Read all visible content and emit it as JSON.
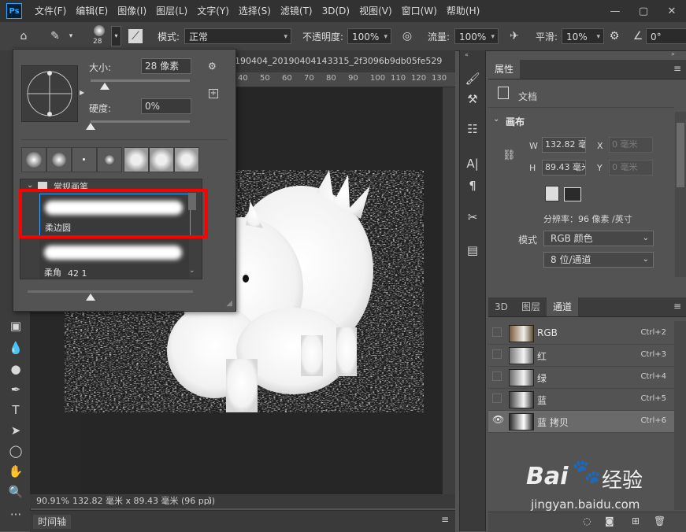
{
  "menubar": {
    "logo": "Ps",
    "items": [
      "文件(F)",
      "编辑(E)",
      "图像(I)",
      "图层(L)",
      "文字(Y)",
      "选择(S)",
      "滤镜(T)",
      "3D(D)",
      "视图(V)",
      "窗口(W)",
      "帮助(H)"
    ]
  },
  "options": {
    "brush_size": "28",
    "mode_label": "模式:",
    "mode_value": "正常",
    "opacity_label": "不透明度:",
    "opacity_value": "100%",
    "flow_label": "流量:",
    "flow_value": "100%",
    "smooth_label": "平滑:",
    "smooth_value": "10%",
    "angle_value": "0°"
  },
  "document": {
    "tab_title": "190404_20190404143315_2f3096b9db05fe529",
    "ruler_marks": [
      "40",
      "50",
      "60",
      "70",
      "80",
      "90",
      "100",
      "110",
      "120",
      "130"
    ],
    "status_zoom": "90.91%",
    "status_size": "132.82 毫米 x 89.43 毫米 (96 ppi)",
    "status_arrow": "〉",
    "timeline_label": "时间轴"
  },
  "brush_picker": {
    "size_label": "大小:",
    "size_value": "28 像素",
    "hardness_label": "硬度:",
    "hardness_value": "0%",
    "group_name": "常规画笔",
    "brush_1_name": "柔边圆",
    "brush_2_name": "柔角",
    "brush_2_size": "42 1",
    "size_fraction": 0.14,
    "hardness_fraction": 0.0
  },
  "properties": {
    "tab": "属性",
    "doc_label": "文档",
    "section": "画布",
    "w_label": "W",
    "w_value": "132.82 毫",
    "x_label": "X",
    "x_value": "0 毫米",
    "h_label": "H",
    "h_value": "89.43 毫米",
    "y_label": "Y",
    "y_value": "0 毫米",
    "resolution": "分辨率：96 像素 /英寸",
    "mode_label": "模式",
    "mode_value": "RGB 颜色",
    "depth_value": "8 位/通道"
  },
  "channels": {
    "tabs": [
      "3D",
      "图层",
      "通道"
    ],
    "rows": [
      {
        "name": "RGB",
        "shortcut": "Ctrl+2",
        "visible": false
      },
      {
        "name": "红",
        "shortcut": "Ctrl+3",
        "visible": false
      },
      {
        "name": "绿",
        "shortcut": "Ctrl+4",
        "visible": false
      },
      {
        "name": "蓝",
        "shortcut": "Ctrl+5",
        "visible": false
      },
      {
        "name": "蓝 拷贝",
        "shortcut": "Ctrl+6",
        "visible": true
      }
    ]
  },
  "watermark": {
    "brand": "Bai",
    "brand2": "经验",
    "url": "jingyan.baidu.com"
  },
  "colors": {
    "highlight_red": "#ff0000",
    "accent_blue": "#3fa2ff"
  }
}
